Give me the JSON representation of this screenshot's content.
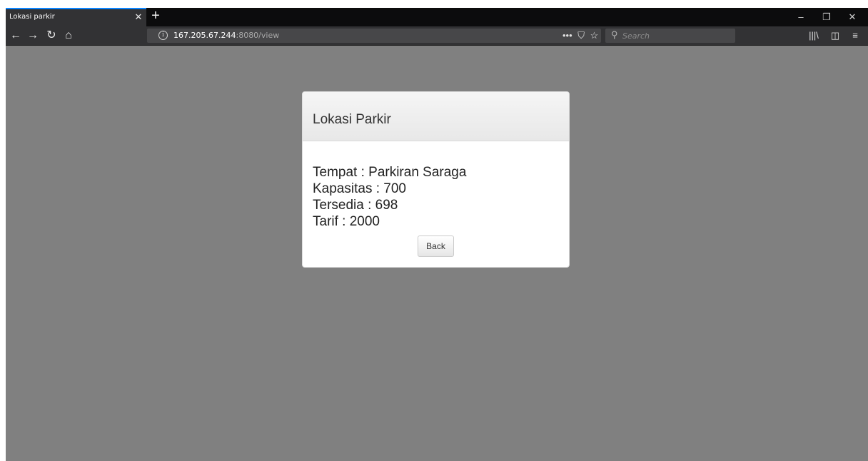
{
  "browser": {
    "tab": {
      "title": "Lokasi parkir",
      "close_glyph": "✕"
    },
    "new_tab_glyph": "+",
    "window_controls": {
      "minimize": "–",
      "restore": "❐",
      "close": "✕"
    },
    "nav": {
      "back": "←",
      "forward": "→",
      "reload": "↻",
      "home": "⌂"
    },
    "url": {
      "info_glyph": "i",
      "host": "167.205.67.244",
      "rest": ":8080/view"
    },
    "url_actions": {
      "more": "•••",
      "pocket": "⛉",
      "bookmark": "☆"
    },
    "search": {
      "icon": "⚲",
      "placeholder": "Search"
    },
    "toolbar_icons": {
      "library": "|||\\",
      "sidebar": "◫",
      "menu": "≡"
    }
  },
  "card": {
    "title": "Lokasi Parkir",
    "lines": [
      "Tempat : Parkiran Saraga",
      "Kapasitas : 700",
      "Tersedia : 698",
      "Tarif : 2000"
    ],
    "back_label": "Back"
  }
}
